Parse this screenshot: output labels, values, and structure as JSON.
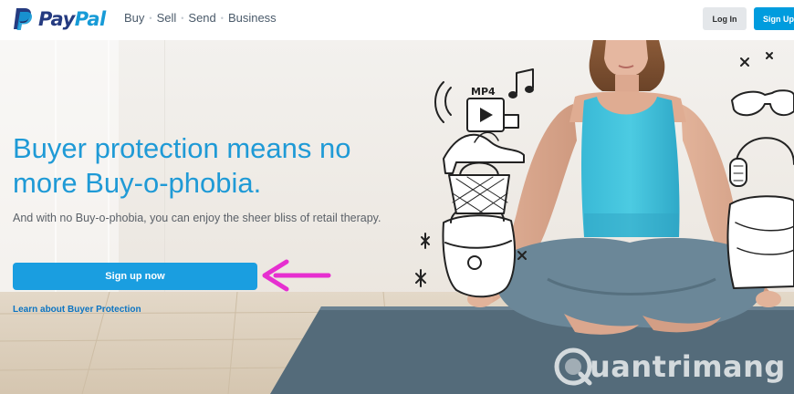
{
  "header": {
    "logo": {
      "pay": "Pay",
      "pal": "Pal"
    },
    "nav": [
      {
        "label": "Buy"
      },
      {
        "label": "Sell"
      },
      {
        "label": "Send"
      },
      {
        "label": "Business"
      }
    ],
    "nav_separator": "•",
    "login_label": "Log In",
    "signup_label": "Sign Up"
  },
  "hero": {
    "headline": "Buyer protection means no more Buy-o-phobia.",
    "subtext": "And with no Buy-o-phobia, you can enjoy the sheer bliss of retail therapy.",
    "cta_label": "Sign up now",
    "learn_link": "Learn about Buyer Protection",
    "doodle_label": "MP4"
  },
  "watermark": {
    "text": "uantrimang"
  },
  "colors": {
    "brand_dark": "#253b80",
    "brand_light": "#179bd7",
    "cta_blue": "#1a9ee0",
    "headline_blue": "#1f9ad6",
    "arrow_magenta": "#e62fd0",
    "tank_top_cyan": "#3cc3dc"
  },
  "icons": {
    "logo_mark": "paypal-p-logo-icon",
    "arrow": "magenta-arrow-icon",
    "watermark_badge": "quantrimang-q-logo-icon"
  }
}
